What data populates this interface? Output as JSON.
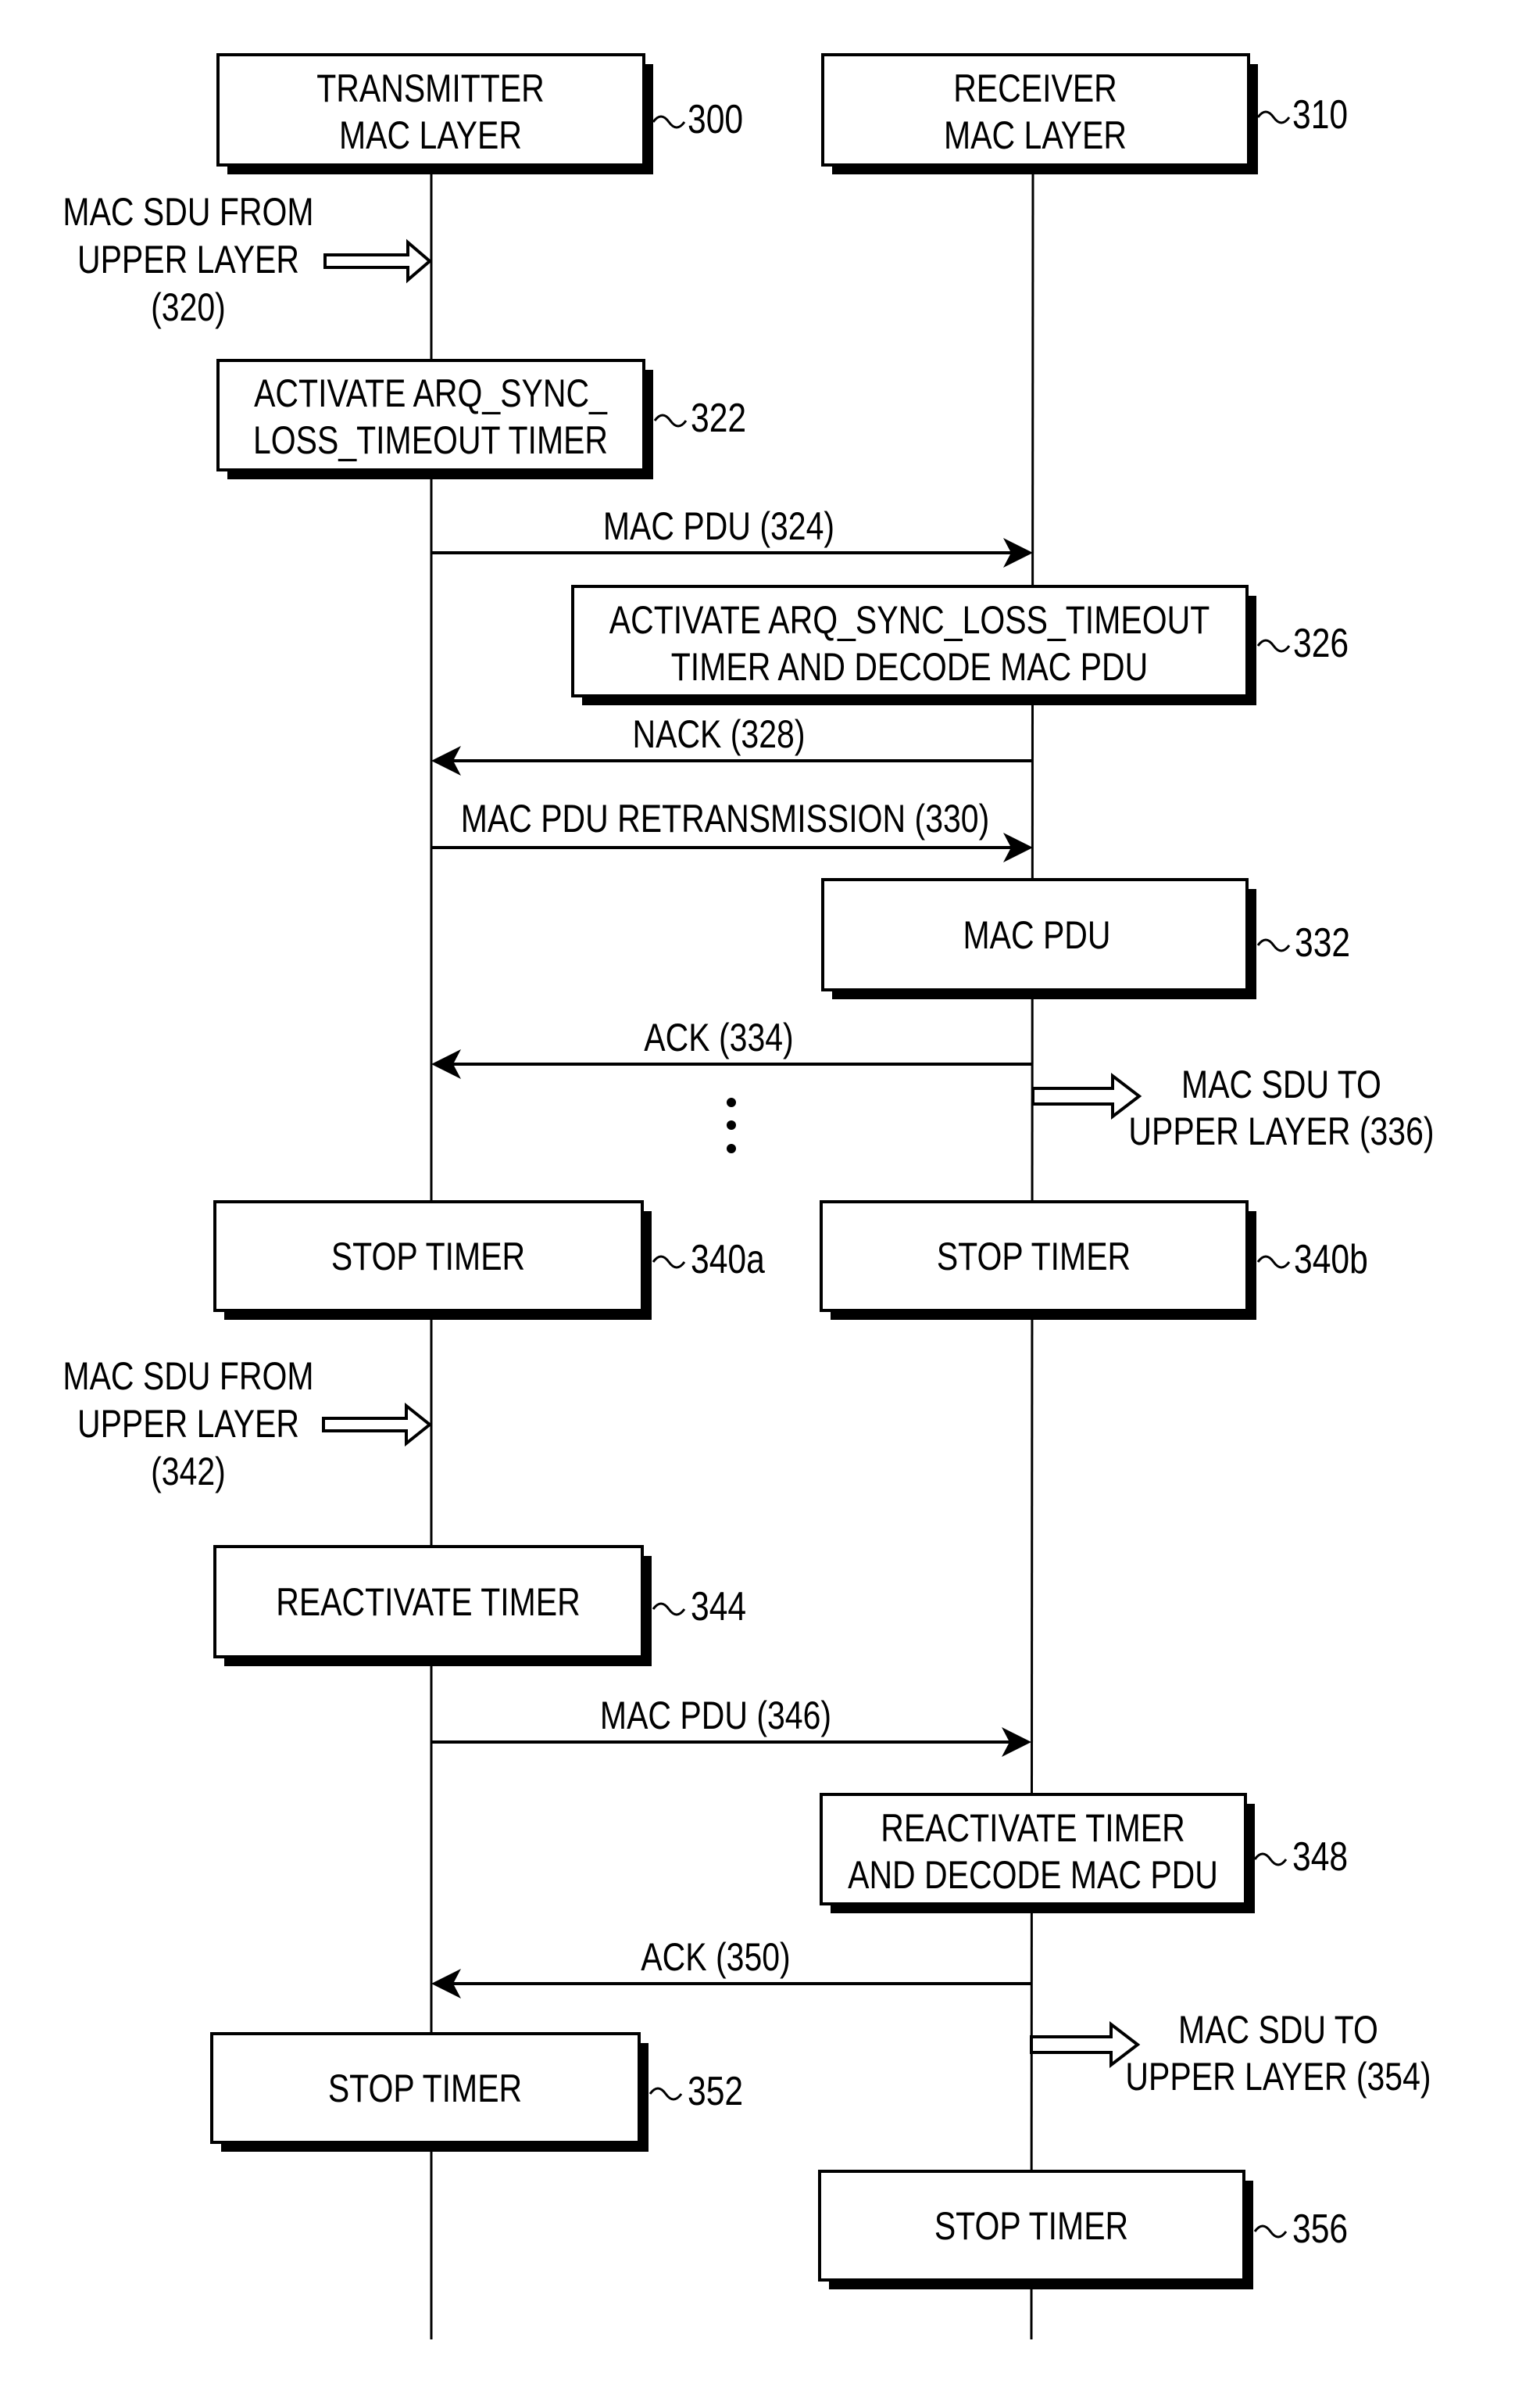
{
  "diagram": {
    "type": "sequence-diagram",
    "participants": [
      {
        "id": "tx",
        "lines": [
          "TRANSMITTER",
          "MAC LAYER"
        ],
        "ref": "300"
      },
      {
        "id": "rx",
        "lines": [
          "RECEIVER",
          "MAC LAYER"
        ],
        "ref": "310"
      }
    ],
    "boxes": [
      {
        "id": "b322",
        "lane": "tx",
        "lines": [
          "ACTIVATE ARQ_SYNC_",
          "LOSS_TIMEOUT TIMER"
        ],
        "ref": "322"
      },
      {
        "id": "b326",
        "lane": "rx",
        "lines": [
          "ACTIVATE ARQ_SYNC_LOSS_TIMEOUT",
          "TIMER AND DECODE MAC PDU"
        ],
        "ref": "326"
      },
      {
        "id": "b332",
        "lane": "rx",
        "lines": [
          "MAC PDU"
        ],
        "ref": "332"
      },
      {
        "id": "b340a",
        "lane": "tx",
        "lines": [
          "STOP TIMER"
        ],
        "ref": "340a"
      },
      {
        "id": "b340b",
        "lane": "rx",
        "lines": [
          "STOP TIMER"
        ],
        "ref": "340b"
      },
      {
        "id": "b344",
        "lane": "tx",
        "lines": [
          "REACTIVATE TIMER"
        ],
        "ref": "344"
      },
      {
        "id": "b348",
        "lane": "rx",
        "lines": [
          "REACTIVATE TIMER",
          "AND DECODE MAC PDU"
        ],
        "ref": "348"
      },
      {
        "id": "b352",
        "lane": "tx",
        "lines": [
          "STOP TIMER"
        ],
        "ref": "352"
      },
      {
        "id": "b356",
        "lane": "rx",
        "lines": [
          "STOP TIMER"
        ],
        "ref": "356"
      }
    ],
    "messages": [
      {
        "id": "m324",
        "from": "tx",
        "to": "rx",
        "label": "MAC PDU (324)"
      },
      {
        "id": "m328",
        "from": "rx",
        "to": "tx",
        "label": "NACK (328)"
      },
      {
        "id": "m330",
        "from": "tx",
        "to": "rx",
        "label": "MAC PDU RETRANSMISSION (330)"
      },
      {
        "id": "m334",
        "from": "rx",
        "to": "tx",
        "label": "ACK (334)"
      },
      {
        "id": "m346",
        "from": "tx",
        "to": "rx",
        "label": "MAC PDU (346)"
      },
      {
        "id": "m350",
        "from": "rx",
        "to": "tx",
        "label": "ACK (350)"
      }
    ],
    "external_inputs": [
      {
        "id": "in320",
        "lines": [
          "MAC SDU FROM",
          "UPPER LAYER",
          "(320)"
        ]
      },
      {
        "id": "in342",
        "lines": [
          "MAC SDU FROM",
          "UPPER LAYER",
          "(342)"
        ]
      }
    ],
    "external_outputs": [
      {
        "id": "out336",
        "lines": [
          "MAC SDU TO",
          "UPPER LAYER (336)"
        ]
      },
      {
        "id": "out354",
        "lines": [
          "MAC SDU TO",
          "UPPER LAYER (354)"
        ]
      }
    ],
    "ellipsis": "continuation-dots"
  }
}
